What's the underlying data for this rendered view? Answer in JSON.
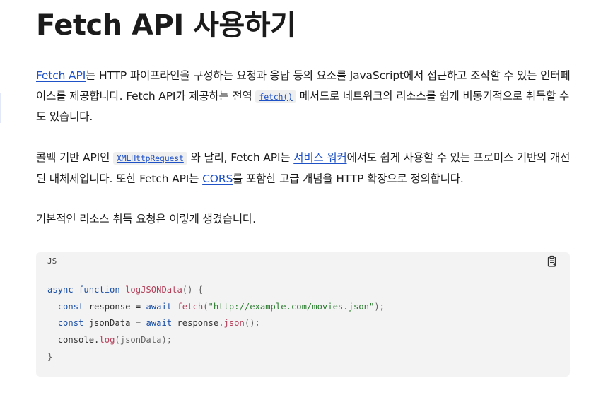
{
  "page": {
    "title": "Fetch API 사용하기"
  },
  "paragraph1": {
    "link_fetch_api": "Fetch API",
    "text_a": "는 HTTP 파이프라인을 구성하는 요청과 응답 등의 요소를 JavaScript에서 접근하고 조작할 수 있는 인터페이스를 제공합니다. Fetch API가 제공하는 전역 ",
    "code_fetch": "fetch()",
    "text_b": " 메서드로 네트워크의 리소스를 쉽게 비동기적으로 취득할 수도 있습니다."
  },
  "paragraph2": {
    "text_a": "콜백 기반 API인 ",
    "code_xhr": "XMLHttpRequest",
    "text_b": " 와 달리, Fetch API는 ",
    "link_service_worker": "서비스 워커",
    "text_c": "에서도 쉽게 사용할 수 있는 프로미스 기반의 개선된 대체제입니다. 또한 Fetch API는 ",
    "link_cors": "CORS",
    "text_d": "를 포함한 고급 개념을 HTTP 확장으로 정의합니다."
  },
  "paragraph3": {
    "text": "기본적인 리소스 취득 요청은 이렇게 생겼습니다."
  },
  "code_block": {
    "language": "JS",
    "copy_icon": "clipboard-copy-icon",
    "tokens": {
      "l1_async": "async",
      "l1_function": "function",
      "l1_name": "logJSONData",
      "l1_rest": "() {",
      "l2_const": "const",
      "l2_var": " response = ",
      "l2_await": "await",
      "l2_fetch": "fetch",
      "l2_open": "(",
      "l2_str": "\"http://example.com/movies.json\"",
      "l2_close": ");",
      "l3_const": "const",
      "l3_var": " jsonData = ",
      "l3_await": "await",
      "l3_obj": " response.",
      "l3_json": "json",
      "l3_close": "();",
      "l4_obj": "console.",
      "l4_log": "log",
      "l4_rest": "(jsonData);",
      "l5_close": "}"
    }
  },
  "colors": {
    "link": "#1f52c7",
    "keyword": "#1a4fa8",
    "function": "#b43f59",
    "string": "#2e7d32",
    "code_bg": "#f3f3f3"
  }
}
